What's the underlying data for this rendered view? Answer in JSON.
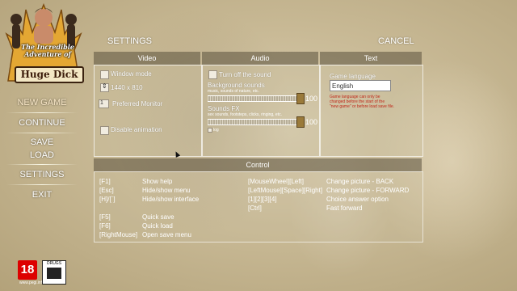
{
  "logo": {
    "subtitle": "The Incredible Adventure of",
    "title": "Huge Dick"
  },
  "menu": {
    "items": [
      {
        "label": "NEW GAME"
      },
      {
        "label": "CONTINUE"
      },
      {
        "label": "SAVE"
      },
      {
        "label": "LOAD"
      },
      {
        "label": "SETTINGS"
      },
      {
        "label": "EXIT"
      }
    ]
  },
  "header": {
    "settings": "SETTINGS",
    "cancel": "CANCEL"
  },
  "video": {
    "heading": "Video",
    "window_mode": "Window mode",
    "resolution": "1440 x 810",
    "monitor_value": "1",
    "monitor_label": "Preferred Monitor",
    "disable_animation": "Disable animation"
  },
  "audio": {
    "heading": "Audio",
    "turn_off": "Turn off the sound",
    "bg_label": "Background sounds",
    "bg_sub": "music, sounds of nature, etc.",
    "bg_value": "100",
    "fx_label": "Sounds FX",
    "fx_sub": "sex sounds, footsteps, clicks, ringing, etc.",
    "fx_value": "100",
    "log_label": "log"
  },
  "text": {
    "heading": "Text",
    "language_label": "Game language",
    "language_value": "English",
    "note": "Game language can only be changed before the start of the \"new game\" or before load save file."
  },
  "control": {
    "heading": "Control",
    "left": [
      {
        "key": "[F1]",
        "action": "Show help"
      },
      {
        "key": "[Esc]",
        "action": "Hide/show menu"
      },
      {
        "key": "[H]/[`]",
        "action": "Hide/show interface"
      },
      {
        "key": "[F5]",
        "action": "Quick save"
      },
      {
        "key": "[F6]",
        "action": "Quick load"
      },
      {
        "key": "[RightMouse]",
        "action": "Open save menu"
      }
    ],
    "right": [
      {
        "key": "[MouseWheel][Left]",
        "action": "Change picture - BACK"
      },
      {
        "key": "[LeftMouse][Space][Right]",
        "action": "Change picture - FORWARD"
      },
      {
        "key": "[1][2][3][4]",
        "action": "Choice answer option"
      },
      {
        "key": "[Ctrl]",
        "action": "Fast forward"
      }
    ]
  },
  "badges": {
    "age": "18",
    "site": "www.pegi.info",
    "peg_label": "DRUGS"
  }
}
